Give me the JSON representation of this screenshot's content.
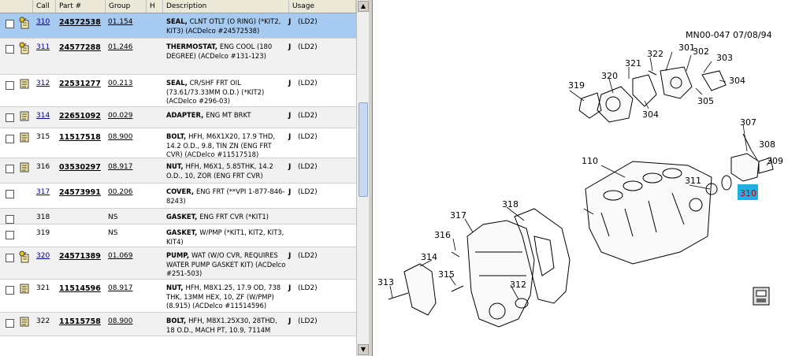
{
  "columns": {
    "call": "Call",
    "part": "Part #",
    "group": "Group",
    "h": "H",
    "description": "Description",
    "usage": "Usage"
  },
  "rows": [
    {
      "call": "310",
      "call_link": true,
      "part": "24572538",
      "group": "01.154",
      "title": "SEAL,",
      "desc": "CLNT OTLT (O RING) (*KIT2, KIT3) (ACDelco #24572538)",
      "h": "J",
      "usage": "(LD2)",
      "icon": "key-note-icon"
    },
    {
      "call": "311",
      "call_link": true,
      "part": "24577288",
      "group": "01.246",
      "title": "THERMOSTAT,",
      "desc": "ENG COOL (180 DEGREE) (ACDelco #131-123)",
      "h": "J",
      "usage": "(LD2)",
      "icon": "key-note-icon"
    },
    {
      "call": "312",
      "call_link": true,
      "part": "22531277",
      "group": "00.213",
      "title": "SEAL,",
      "desc": "CR/SHF FRT OIL (73.61/73.33MM O.D.) (*KIT2) (ACDelco #296-03)",
      "h": "J",
      "usage": "(LD2)",
      "icon": "note-icon"
    },
    {
      "call": "314",
      "call_link": true,
      "part": "22651092",
      "group": "00.029",
      "title": "ADAPTER,",
      "desc": "ENG MT BRKT",
      "h": "J",
      "usage": "(LD2)",
      "icon": "note-icon"
    },
    {
      "call": "315",
      "call_link": false,
      "part": "11517518",
      "group": "08.900",
      "title": "BOLT,",
      "desc": "HFH, M6X1X20, 17.9 THD, 14.2 O.D., 9.8, TIN ZN (ENG FRT CVR) (ACDelco #11517518)",
      "h": "J",
      "usage": "(LD2)",
      "icon": "note-icon"
    },
    {
      "call": "316",
      "call_link": false,
      "part": "03530297",
      "group": "08.917",
      "title": "NUT,",
      "desc": "HFH, M6X1, 5.85THK, 14.2 O.D., 10, ZOR (ENG FRT CVR)",
      "h": "J",
      "usage": "(LD2)",
      "icon": "note-icon"
    },
    {
      "call": "317",
      "call_link": true,
      "part": "24573991",
      "group": "00.206",
      "title": "COVER,",
      "desc": "ENG FRT (**VPI 1-877-846-8243)",
      "h": "J",
      "usage": "(LD2)",
      "icon": ""
    },
    {
      "call": "318",
      "call_link": false,
      "part": "",
      "group": "NS",
      "title": "GASKET,",
      "desc": "ENG FRT CVR (*KIT1)",
      "h": "",
      "usage": "",
      "icon": ""
    },
    {
      "call": "319",
      "call_link": false,
      "part": "",
      "group": "NS",
      "title": "GASKET,",
      "desc": "W/PMP (*KIT1, KIT2, KIT3, KIT4)",
      "h": "",
      "usage": "",
      "icon": ""
    },
    {
      "call": "320",
      "call_link": true,
      "part": "24571389",
      "group": "01.069",
      "title": "PUMP,",
      "desc": "WAT (W/O CVR, REQUIRES WATER PUMP GASKET KIT) (ACDelco #251-503)",
      "h": "J",
      "usage": "(LD2)",
      "icon": "key-note-icon"
    },
    {
      "call": "321",
      "call_link": false,
      "part": "11514596",
      "group": "08.917",
      "title": "NUT,",
      "desc": "HFH, M8X1.25, 17.9 OD, 738 THK, 13MM HEX, 10, ZF (W/PMP) (8.915) (ACDelco #11514596)",
      "h": "J",
      "usage": "(LD2)",
      "icon": "note-icon"
    },
    {
      "call": "322",
      "call_link": false,
      "part": "11515758",
      "group": "08.900",
      "title": "BOLT,",
      "desc": "HFH, M8X1.25X30, 28THD, 18 O.D., MACH PT, 10.9, 7114M",
      "h": "J",
      "usage": "(LD2)",
      "icon": "note-icon"
    }
  ],
  "diagram": {
    "header": "MN00-047 07/08/94",
    "highlight": "310",
    "labels": [
      "301",
      "302",
      "303",
      "304",
      "304",
      "305",
      "307",
      "308",
      "309",
      "310",
      "311",
      "312",
      "313",
      "314",
      "315",
      "316",
      "317",
      "318",
      "319",
      "320",
      "321",
      "322",
      "110"
    ]
  },
  "colors": {
    "selected_row": "#a6caf0",
    "highlight": "#1ab0e8"
  }
}
